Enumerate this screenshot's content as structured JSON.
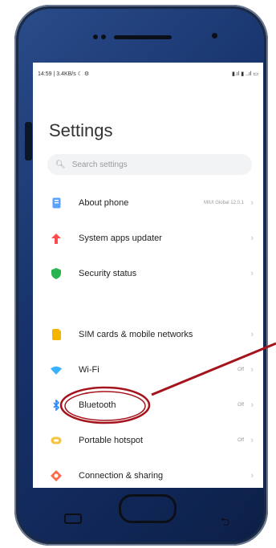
{
  "status": {
    "left": "14:59 | 3.4KB/s ☾ ⚙",
    "right": "▮.ıl ▮ ..ıl ▭"
  },
  "title": "Settings",
  "search": {
    "placeholder": "Search settings"
  },
  "items": [
    {
      "label": "About phone",
      "value": "MIUI Global 12.0.1",
      "icon": "phone-info-icon",
      "color": "#5aa2ff"
    },
    {
      "label": "System apps updater",
      "value": "",
      "icon": "arrow-up-icon",
      "color": "#ff4b4b"
    },
    {
      "label": "Security status",
      "value": "",
      "icon": "shield-icon",
      "color": "#27b34e"
    },
    {
      "label": "SIM cards & mobile networks",
      "value": "",
      "icon": "sim-icon",
      "color": "#f5b400"
    },
    {
      "label": "Wi-Fi",
      "value": "Off",
      "icon": "wifi-icon",
      "color": "#3ab2ff"
    },
    {
      "label": "Bluetooth",
      "value": "Off",
      "icon": "bluetooth-icon",
      "color": "#2a88ff"
    },
    {
      "label": "Portable hotspot",
      "value": "Off",
      "icon": "hotspot-icon",
      "color": "#f5c542"
    },
    {
      "label": "Connection & sharing",
      "value": "",
      "icon": "share-icon",
      "color": "#ff6b4b"
    }
  ]
}
